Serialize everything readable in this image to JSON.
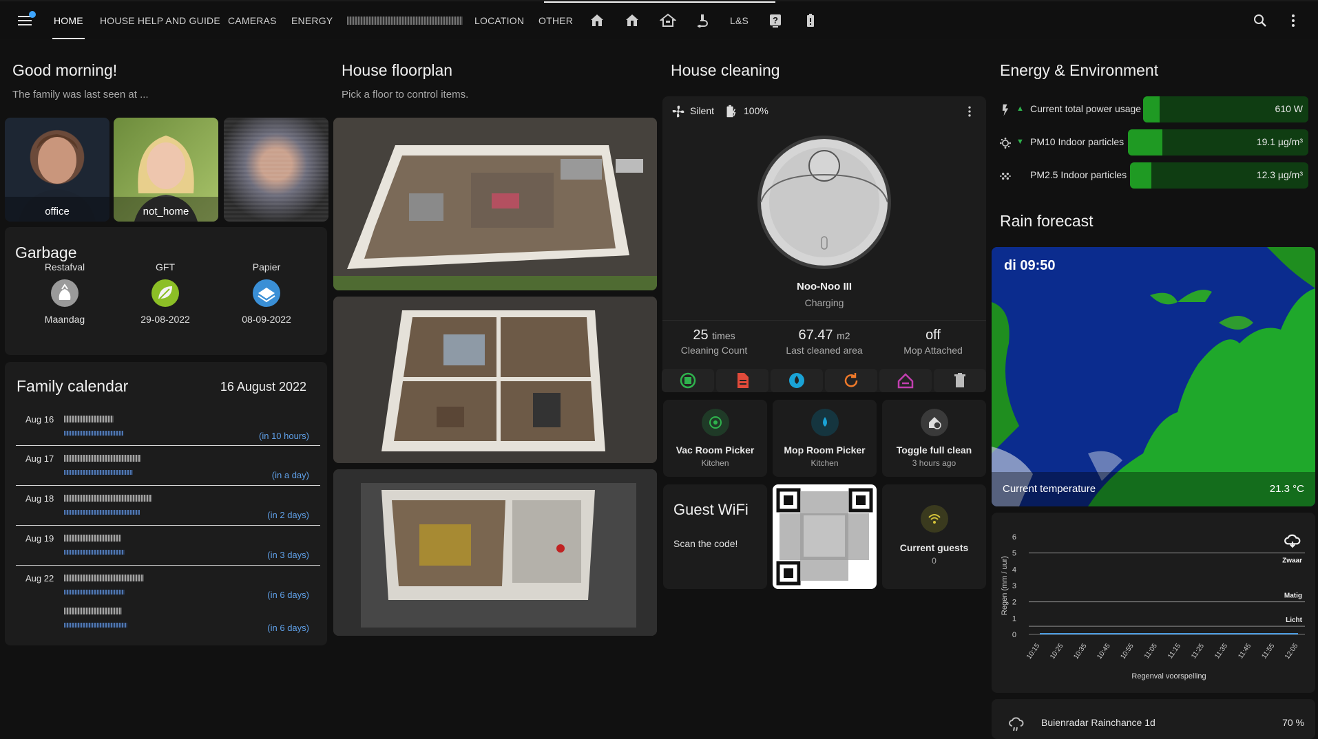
{
  "tabs": [
    {
      "label": "HOME"
    },
    {
      "label": "HOUSE HELP AND GUIDE"
    },
    {
      "label": "CAMERAS"
    },
    {
      "label": "ENERGY"
    },
    {
      "label": "LOCATION"
    },
    {
      "label": "OTHER"
    },
    {
      "label": "L&S"
    }
  ],
  "greeting": {
    "title": "Good morning!",
    "subtitle": "The family was last seen at ..."
  },
  "persons": [
    {
      "label": "office"
    },
    {
      "label": "not_home"
    },
    {
      "label": ""
    }
  ],
  "garbage": {
    "title": "Garbage",
    "items": [
      {
        "name": "Restafval",
        "date": "Maandag",
        "color": "#9a9a9a"
      },
      {
        "name": "GFT",
        "date": "29-08-2022",
        "color": "#8cbf26"
      },
      {
        "name": "Papier",
        "date": "08-09-2022",
        "color": "#3a8fd6"
      }
    ]
  },
  "calendar": {
    "title": "Family calendar",
    "date": "16 August 2022",
    "events": [
      {
        "date": "Aug 16",
        "rel": "(in 10 hours)"
      },
      {
        "date": "Aug 17",
        "rel": "(in a day)"
      },
      {
        "date": "Aug 18",
        "rel": "(in 2 days)"
      },
      {
        "date": "Aug 19",
        "rel": "(in 3 days)"
      },
      {
        "date": "Aug 22",
        "rel": "(in 6 days)"
      },
      {
        "date": "",
        "rel": "(in 6 days)"
      }
    ]
  },
  "floorplan": {
    "title": "House floorplan",
    "subtitle": "Pick a floor to control items."
  },
  "cleaning": {
    "title": "House cleaning",
    "fan": "Silent",
    "battery": "100%",
    "name": "Noo-Noo III",
    "status": "Charging",
    "stats": [
      {
        "value": "25",
        "unit": "times",
        "label": "Cleaning Count"
      },
      {
        "value": "67.47",
        "unit": "m2",
        "label": "Last cleaned area"
      },
      {
        "value": "off",
        "unit": "",
        "label": "Mop Attached"
      }
    ],
    "tiles": [
      {
        "title": "Vac Room Picker",
        "sub": "Kitchen"
      },
      {
        "title": "Mop Room Picker",
        "sub": "Kitchen"
      },
      {
        "title": "Toggle full clean",
        "sub": "3 hours ago"
      }
    ]
  },
  "wifi": {
    "title": "Guest WiFi",
    "text": "Scan the code!",
    "guests_title": "Current guests",
    "guests": "0"
  },
  "energy": {
    "title": "Energy & Environment",
    "rows": [
      {
        "name": "Current total power usage",
        "value": "610 W",
        "fill": 0.06
      },
      {
        "name": "PM10 Indoor particles",
        "value": "19.1 µg/m³",
        "fill": 0.19
      },
      {
        "name": "PM2.5 Indoor particles",
        "value": "12.3 µg/m³",
        "fill": 0.12
      }
    ]
  },
  "rain": {
    "title": "Rain forecast",
    "map_time": "di 09:50",
    "temp_label": "Current temperature",
    "temp_value": "21.3 °C",
    "chance_label": "Buienradar Rainchance 1d",
    "chance_value": "70 %"
  },
  "chart_data": {
    "type": "line",
    "x": [
      "10:15",
      "10:25",
      "10:35",
      "10:45",
      "10:55",
      "11:05",
      "11:15",
      "11:25",
      "11:35",
      "11:45",
      "11:55",
      "12:05"
    ],
    "series": [
      {
        "values": [
          0,
          0,
          0,
          0,
          0,
          0,
          0,
          0,
          0,
          0,
          0,
          0
        ]
      }
    ],
    "ylabel": "Regen (mm / uur)",
    "xlabel": "Regenval voorspelling",
    "ylim": [
      0,
      6
    ],
    "yticks": [
      "0",
      "1",
      "2",
      "3",
      "4",
      "5",
      "6"
    ],
    "thresholds": [
      {
        "label": "Zwaar",
        "value": 5
      },
      {
        "label": "Matig",
        "value": 2
      },
      {
        "label": "Licht",
        "value": 0.5
      }
    ]
  }
}
